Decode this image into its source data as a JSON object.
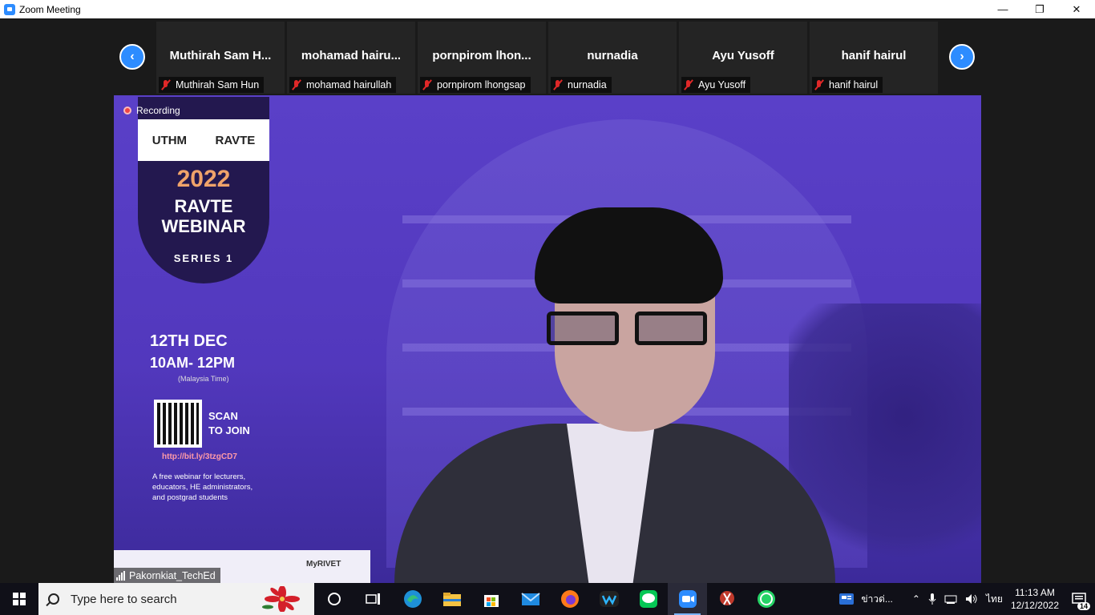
{
  "window": {
    "title": "Zoom Meeting"
  },
  "gallery": {
    "participants": [
      {
        "display": "Muthirah Sam H...",
        "label": "Muthirah Sam Hun"
      },
      {
        "display": "mohamad hairu...",
        "label": "mohamad hairullah"
      },
      {
        "display": "pornpirom lhon...",
        "label": "pornpirom lhongsap"
      },
      {
        "display": "nurnadia",
        "label": "nurnadia"
      },
      {
        "display": "Ayu Yusoff",
        "label": "Ayu Yusoff"
      },
      {
        "display": "hanif hairul",
        "label": "hanif hairul"
      }
    ]
  },
  "video": {
    "recording_label": "Recording",
    "speaker_name": "Pakornkiat_TechEd",
    "poster": {
      "logo_left": "UTHM",
      "logo_right": "RAVTE",
      "year": "2022",
      "title_line1": "RAVTE",
      "title_line2": "WEBINAR",
      "series": "SERIES 1",
      "date": "12TH DEC",
      "time": "10AM- 12PM",
      "timezone": "(Malaysia Time)",
      "scan_line1": "SCAN",
      "scan_line2": "TO JOIN",
      "link": "http://bit.ly/3tzgCD7",
      "description": "A free webinar for lecturers, educators, HE administrators, and postgrad students",
      "footer_logo": "MyRIVET"
    }
  },
  "taskbar": {
    "search_placeholder": "Type here to search",
    "news_label": "ข่าวด่...",
    "language": "ไทย",
    "time": "11:13 AM",
    "date": "12/12/2022",
    "notification_count": "14"
  }
}
